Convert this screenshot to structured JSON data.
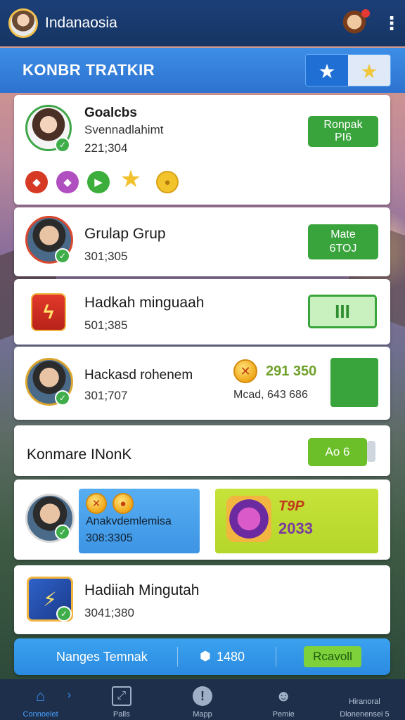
{
  "app": {
    "title": "Indanaosia"
  },
  "banner": {
    "title": "KONBR TRATKIR"
  },
  "cards": [
    {
      "name": "Goalcbs",
      "subtitle": "Svennadlahimt",
      "stat": "221;304",
      "button": {
        "line1": "Ronpak",
        "line2": "PI6"
      }
    },
    {
      "name": "Grulap Grup",
      "stat": "301;305",
      "button": {
        "line1": "Mate",
        "line2": "6TOJ"
      }
    },
    {
      "name": "Hadkah minguaah",
      "stat": "501;385",
      "button": {
        "label": "III"
      }
    },
    {
      "name": "Hackasd rohenem",
      "stat": "301;707",
      "score": "291 350",
      "score_sub": "Mcad, 643 686"
    },
    {
      "name": "Konmare INonK",
      "button": {
        "label": "Ao 6"
      }
    },
    {
      "name": "Anakvdemlemisa",
      "stat": "308:3305",
      "promo": {
        "top": "T9P",
        "bottom": "2033"
      }
    },
    {
      "name": "Hadiiah Mingutah",
      "stat": "3041;380"
    }
  ],
  "reward_bar": {
    "left": "Nanges Temnak",
    "mid": "1480",
    "button": "Rcavoll"
  },
  "nav": [
    {
      "label": "Connoelet",
      "icon": "home-icon"
    },
    {
      "label": "Palls",
      "icon": "map-icon"
    },
    {
      "label": "Mapp",
      "icon": "info-icon"
    },
    {
      "label": "Pemie",
      "icon": "profile-icon"
    },
    {
      "label": "Dlonenensei 5",
      "top": "Hiranoral",
      "icon": "settings-icon"
    }
  ],
  "colors": {
    "topbar": "#163563",
    "banner": "#2d72cf",
    "accent_green": "#39a43c",
    "lime": "#b5d62b"
  }
}
